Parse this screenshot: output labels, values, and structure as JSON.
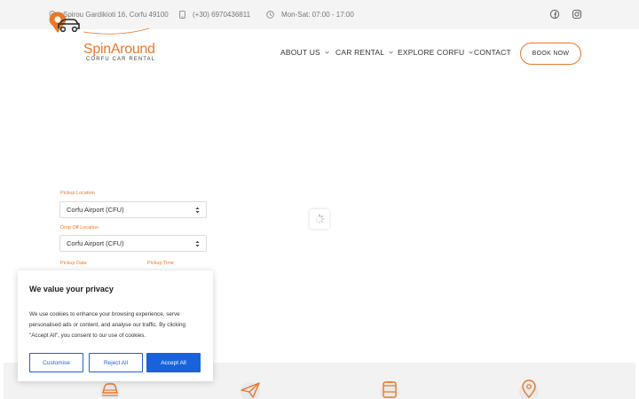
{
  "topbar": {
    "address": "Spirou Gardikioti 16, Corfu 49100",
    "phone": "(+30) 6970436811",
    "hours": "Mon-Sat: 07:00 - 17:00"
  },
  "brand": {
    "name": "SpinAround",
    "tagline": "CORFU CAR RENTAL",
    "accent": "#e8782a"
  },
  "nav": {
    "items": [
      {
        "label": "ABOUT US"
      },
      {
        "label": "CAR RENTAL"
      },
      {
        "label": "EXPLORE CORFU"
      },
      {
        "label": "CONTACT"
      }
    ],
    "book_label": "BOOK NOW"
  },
  "form": {
    "pickup_location_label": "Pickup Location",
    "pickup_location_value": "Corfu Airport (CFU)",
    "dropoff_location_label": "Drop Off Location",
    "dropoff_location_value": "Corfu Airport (CFU)",
    "pickup_date_label": "Pickup Date",
    "pickup_time_label": "Pickup Time"
  },
  "cookie": {
    "title": "We value your privacy",
    "body": "We use cookies to enhance your browsing experience, serve personalised ads or content, and analyse our traffic. By clicking \"Accept All\", you consent to our use of cookies.",
    "customise_label": "Customise",
    "reject_label": "Reject All",
    "accept_label": "Accept All",
    "button_color": "#1863dc"
  },
  "icons": {
    "address": "location-pin-icon",
    "phone": "phone-icon",
    "hours": "clock-icon",
    "facebook": "facebook-icon",
    "instagram": "instagram-icon"
  }
}
